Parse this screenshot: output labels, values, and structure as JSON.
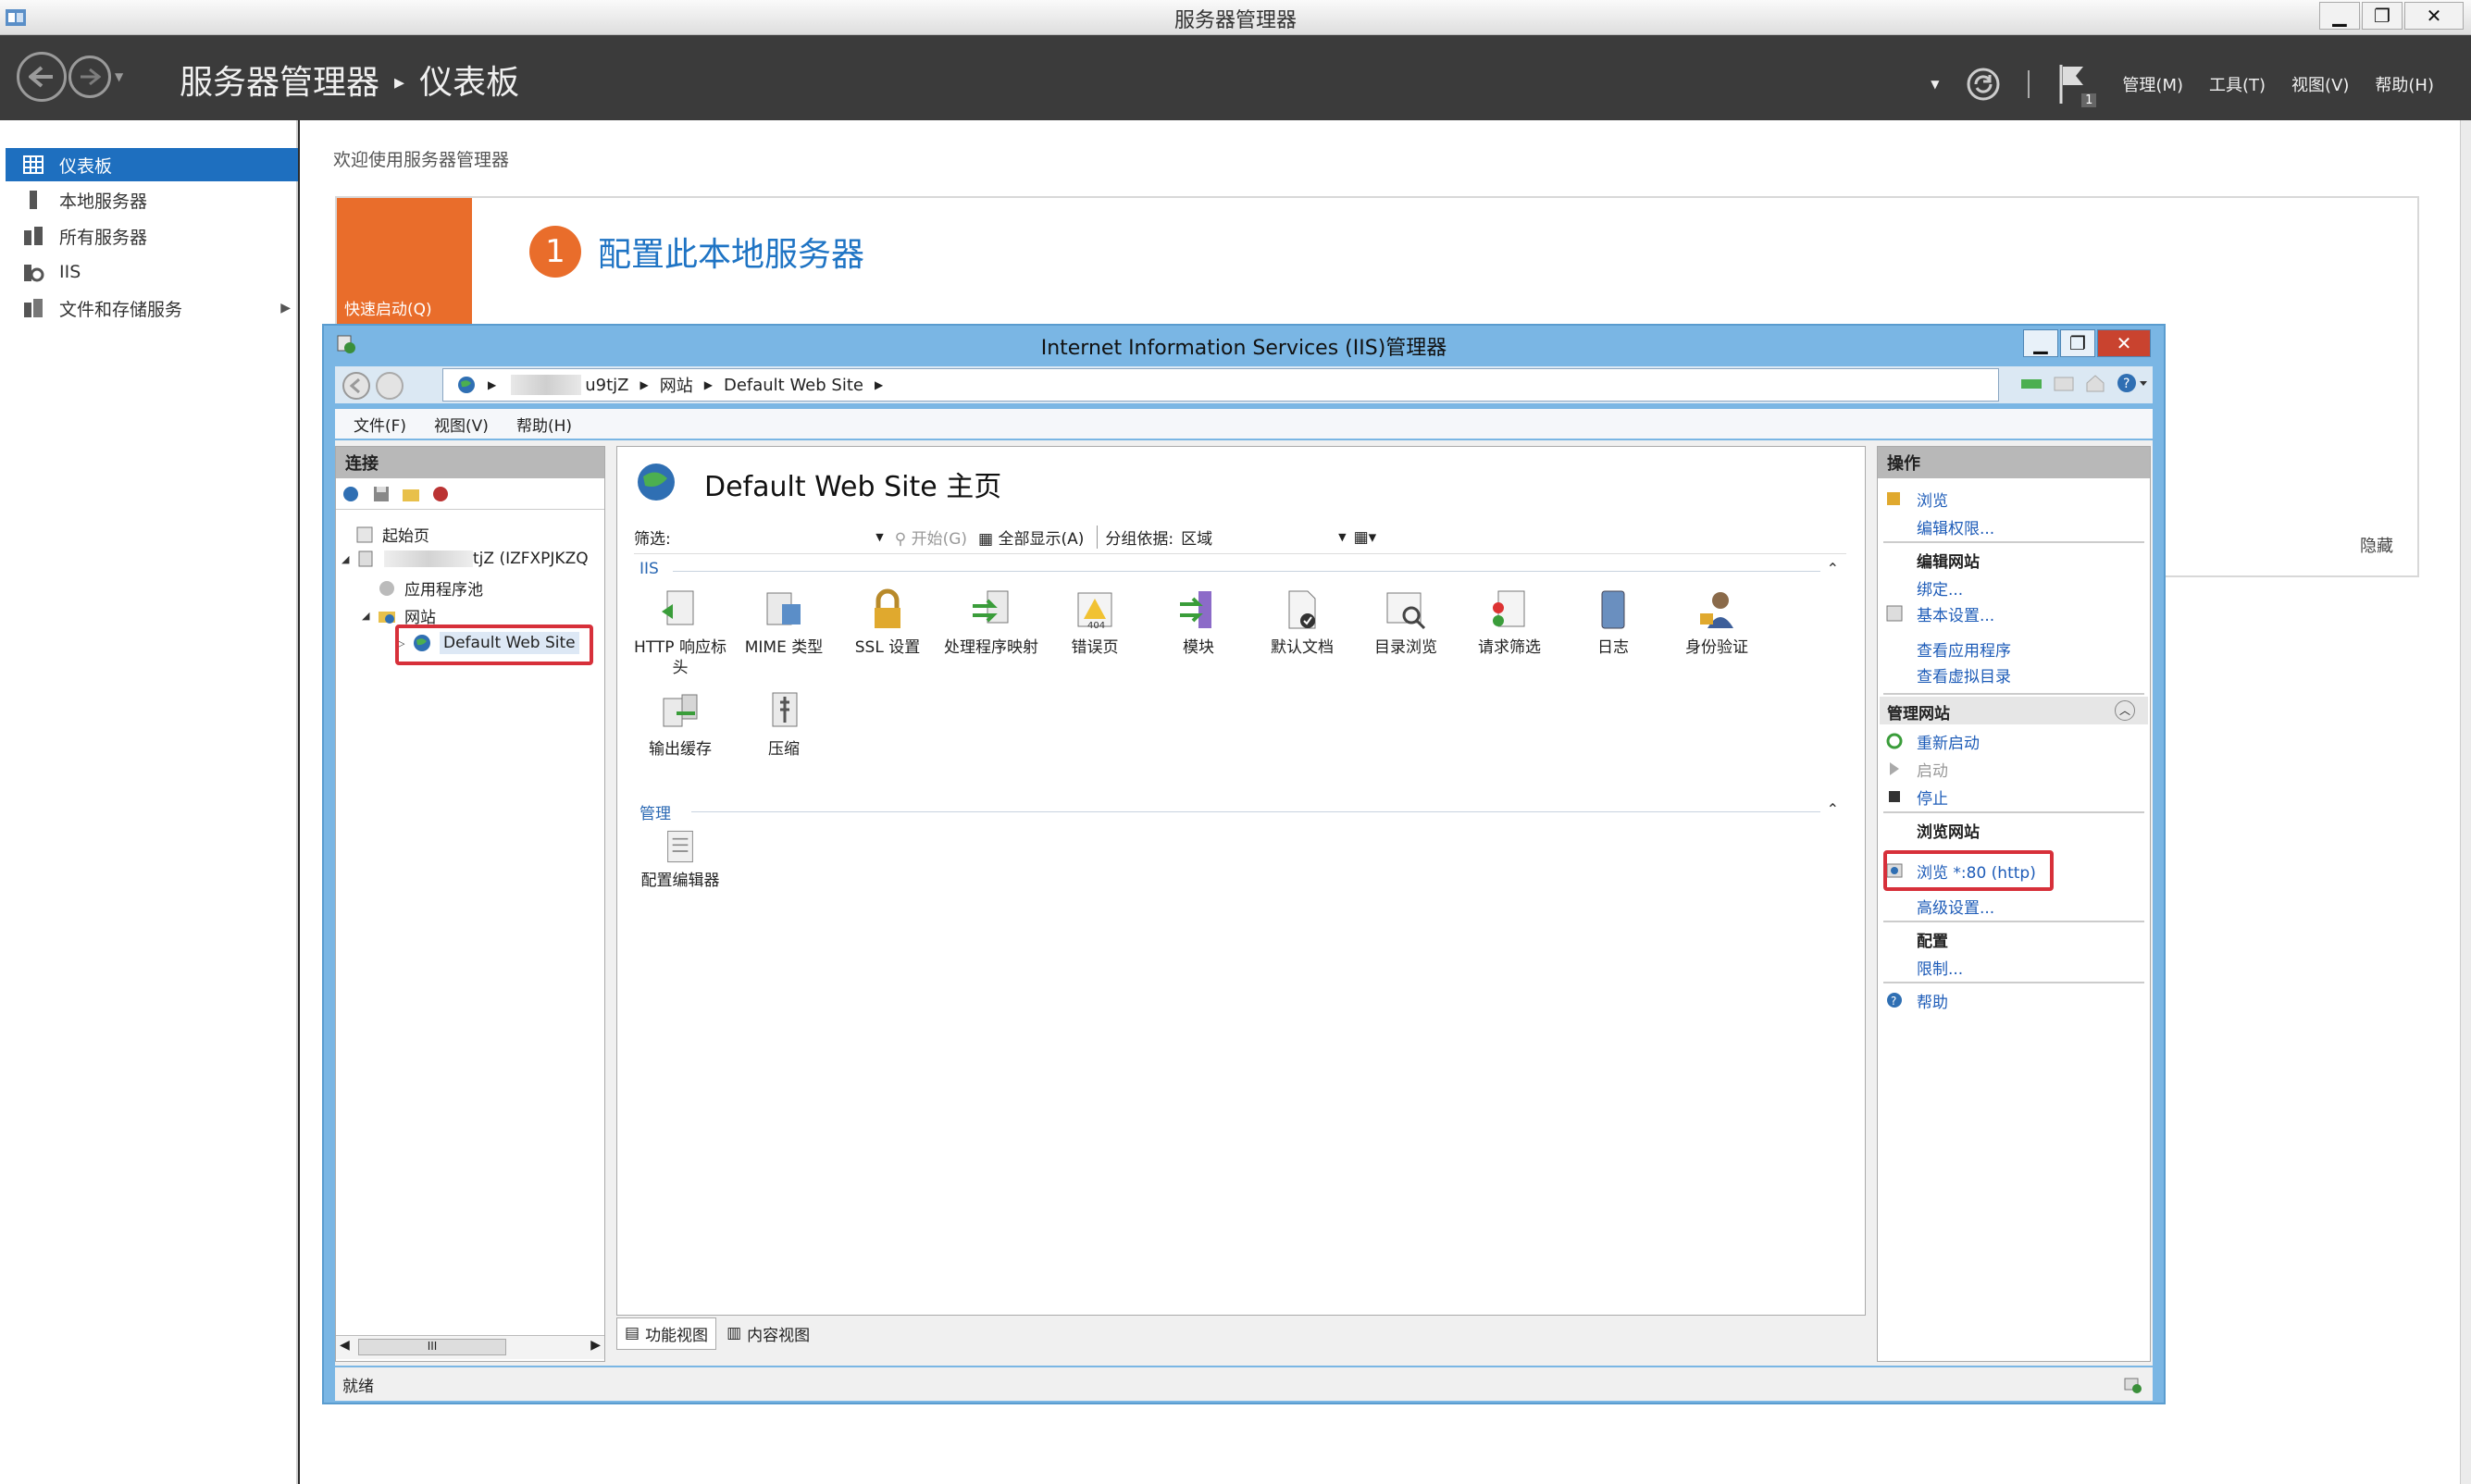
{
  "window": {
    "title": "服务器管理器"
  },
  "window_buttons": {
    "minimize": "▁",
    "restore": "❐",
    "close": "✕"
  },
  "header": {
    "breadcrumb": [
      "服务器管理器",
      "仪表板"
    ],
    "notification_badge": "1",
    "menus": [
      "管理(M)",
      "工具(T)",
      "视图(V)",
      "帮助(H)"
    ]
  },
  "sidebar": {
    "items": [
      {
        "label": "仪表板",
        "icon": "dashboard-icon",
        "active": true
      },
      {
        "label": "本地服务器",
        "icon": "server-icon"
      },
      {
        "label": "所有服务器",
        "icon": "servers-icon"
      },
      {
        "label": "IIS",
        "icon": "iis-icon"
      },
      {
        "label": "文件和存储服务",
        "icon": "storage-icon",
        "expandable": true
      }
    ]
  },
  "content": {
    "welcome": "欢迎使用服务器管理器",
    "quickstart_label": "快速启动(Q)",
    "step_number": "1",
    "step_heading": "配置此本地服务器",
    "hide_link": "隐藏"
  },
  "iis": {
    "title": "Internet Information Services (IIS)管理器",
    "address": {
      "segments": [
        "u9tjZ",
        "网站",
        "Default Web Site"
      ]
    },
    "menus": [
      "文件(F)",
      "视图(V)",
      "帮助(H)"
    ],
    "connections": {
      "header": "连接",
      "tree": {
        "start_page": "起始页",
        "server": "tjZ (IZFXPJKZQ",
        "app_pools": "应用程序池",
        "sites": "网站",
        "default_site": "Default Web Site"
      },
      "scroll_thumb": "III"
    },
    "center": {
      "title": "Default Web Site 主页",
      "filter_label": "筛选:",
      "start_button": "开始(G)",
      "show_all": "全部显示(A)",
      "group_by_label": "分组依据:",
      "group_by_value": "区域",
      "groups": [
        {
          "name": "IIS",
          "features": [
            {
              "label": "HTTP 响应标头",
              "icon": "http-headers-icon"
            },
            {
              "label": "MIME 类型",
              "icon": "mime-icon"
            },
            {
              "label": "SSL 设置",
              "icon": "ssl-lock-icon"
            },
            {
              "label": "处理程序映射",
              "icon": "handler-icon"
            },
            {
              "label": "错误页",
              "icon": "error-page-icon"
            },
            {
              "label": "模块",
              "icon": "modules-icon"
            },
            {
              "label": "默认文档",
              "icon": "default-doc-icon"
            },
            {
              "label": "目录浏览",
              "icon": "dir-browse-icon"
            },
            {
              "label": "请求筛选",
              "icon": "request-filter-icon"
            },
            {
              "label": "日志",
              "icon": "log-icon"
            },
            {
              "label": "身份验证",
              "icon": "auth-icon"
            },
            {
              "label": "输出缓存",
              "icon": "output-cache-icon"
            },
            {
              "label": "压缩",
              "icon": "compress-icon"
            }
          ]
        },
        {
          "name": "管理",
          "features": [
            {
              "label": "配置编辑器",
              "icon": "config-editor-icon"
            }
          ]
        }
      ],
      "view_tabs": [
        "功能视图",
        "内容视图"
      ]
    },
    "actions": {
      "header": "操作",
      "browse": "浏览",
      "edit_permissions": "编辑权限...",
      "edit_site": "编辑网站",
      "bindings": "绑定...",
      "basic_settings": "基本设置...",
      "view_apps": "查看应用程序",
      "view_vdirs": "查看虚拟目录",
      "manage_site": "管理网站",
      "restart": "重新启动",
      "start": "启动",
      "stop": "停止",
      "browse_site": "浏览网站",
      "browse_80": "浏览 *:80 (http)",
      "advanced": "高级设置...",
      "configure": "配置",
      "limits": "限制...",
      "help": "帮助"
    },
    "status": "就绪"
  }
}
